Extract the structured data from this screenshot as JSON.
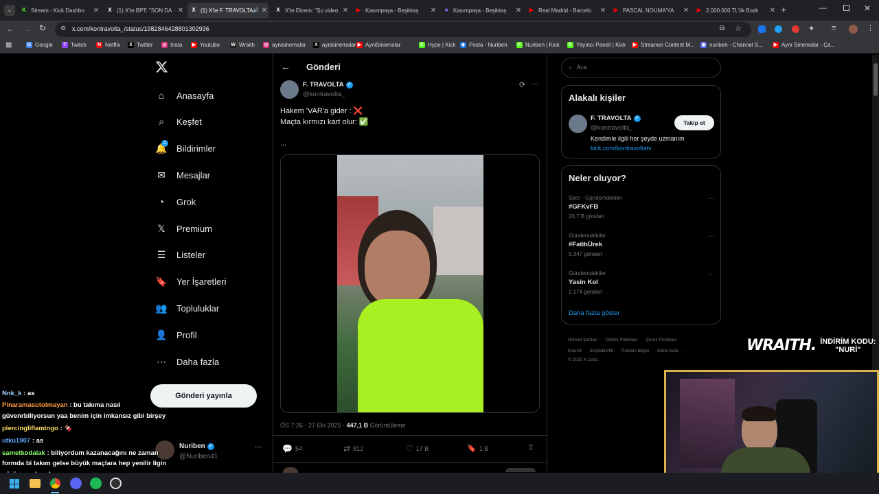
{
  "tabs": [
    {
      "title": "Stream - Kick Dashbo",
      "favicon": "K",
      "color": "#53fc18"
    },
    {
      "title": "(1) X'te BPT: \"SON DA",
      "favicon": "X",
      "color": "#000"
    },
    {
      "title": "(1) X'te F. TRAVOLTA",
      "favicon": "X",
      "color": "#000",
      "active": true
    },
    {
      "title": "X'te Ekrem: \"Şu video",
      "favicon": "X",
      "color": "#000"
    },
    {
      "title": "Kasımpaşa - Beşiktaş",
      "favicon": "▶",
      "color": "#ff0000"
    },
    {
      "title": "Kasımpaşa - Beşiktaş",
      "favicon": "■",
      "color": "#7b5cd6"
    },
    {
      "title": "Real Madrid - Barcelo",
      "favicon": "▶",
      "color": "#ff0000"
    },
    {
      "title": "PASCAL NOUMA'YA",
      "favicon": "▶",
      "color": "#ff0000"
    },
    {
      "title": "2.000.000 TL'lik Bozk",
      "favicon": "▶",
      "color": "#ff0000"
    }
  ],
  "browser": {
    "url": "x.com/kontravolta_/status/1982846428801302936"
  },
  "bookmarks": [
    {
      "label": "Google",
      "color": "#4285f4",
      "g": "G"
    },
    {
      "label": "Twitch",
      "color": "#9146ff",
      "g": "T"
    },
    {
      "label": "Netflix",
      "color": "#e50914",
      "g": "N"
    },
    {
      "label": "Twitter",
      "color": "#000",
      "g": "X"
    },
    {
      "label": "Insta",
      "color": "#d62976",
      "g": "◎"
    },
    {
      "label": "Youtube",
      "color": "#ff0000",
      "g": "▶"
    },
    {
      "label": "Wraith",
      "color": "#222",
      "g": "W"
    },
    {
      "label": "aynisinemalar",
      "color": "#d62976",
      "g": "◎"
    },
    {
      "label": "aynisinemalar",
      "color": "#000",
      "g": "X"
    },
    {
      "label": "AyniSinemalar",
      "color": "#ff0000",
      "g": "▶"
    },
    {
      "label": "Hype | Kick",
      "color": "#53fc18",
      "g": "K"
    },
    {
      "label": "Posta - Nuriben",
      "color": "#1a73e8",
      "g": "◆"
    },
    {
      "label": "Nuriben | Kick",
      "color": "#53fc18",
      "g": "K"
    },
    {
      "label": "Yayıncı Paneli | Kick",
      "color": "#53fc18",
      "g": "K"
    },
    {
      "label": "Streamer Content M...",
      "color": "#ff0000",
      "g": "▶"
    },
    {
      "label": "nuriben - Channel S...",
      "color": "#5865f2",
      "g": "◉"
    },
    {
      "label": "Aynı Sinemalar - Ça...",
      "color": "#ff0000",
      "g": "▶"
    }
  ],
  "nav": {
    "items": [
      {
        "label": "Anasayfa",
        "icon": "home-icon"
      },
      {
        "label": "Keşfet",
        "icon": "search-icon"
      },
      {
        "label": "Bildirimler",
        "icon": "bell-icon",
        "badge": "1"
      },
      {
        "label": "Mesajlar",
        "icon": "mail-icon"
      },
      {
        "label": "Grok",
        "icon": "grok-icon"
      },
      {
        "label": "Premium",
        "icon": "x-logo-icon"
      },
      {
        "label": "Listeler",
        "icon": "list-icon"
      },
      {
        "label": "Yer İşaretleri",
        "icon": "bookmark-icon"
      },
      {
        "label": "Topluluklar",
        "icon": "communities-icon"
      },
      {
        "label": "Profil",
        "icon": "profile-icon"
      },
      {
        "label": "Daha fazla",
        "icon": "more-circle-icon"
      }
    ],
    "post_button": "Gönderi yayınla",
    "account": {
      "name": "Nuriben",
      "handle": "@Nuriben41"
    }
  },
  "post": {
    "header_title": "Gönderi",
    "author_name": "F. TRAVOLTA",
    "author_handle": "@kontravolta_",
    "line1": "Hakem 'VAR'a gider : ❌",
    "line2": "Maçta kırmızı kart olur: ✅",
    "ellipsis": "...",
    "timestamp": "ÖS 7:26 · 27 Eki 2025 · ",
    "views": "447,1 B",
    "views_label": "Görüntüleme",
    "replies": "54",
    "reposts": "812",
    "likes": "17 B",
    "bookmarks": "1 B"
  },
  "search": {
    "placeholder": "Ara"
  },
  "related": {
    "title": "Alakalı kişiler",
    "name": "F. TRAVOLTA",
    "handle": "@kontravolta_",
    "follow": "Takip et",
    "bio": "Kendimle ilgili her şeyde uzmanım",
    "link": "kick.com/kontravoltatv"
  },
  "trends": {
    "title": "Neler oluyor?",
    "items": [
      {
        "context": "Spor · Gündemdekiler",
        "name": "#GFKvFB",
        "count": "20,7 B gönderi"
      },
      {
        "context": "Gündemdekiler",
        "name": "#FatihÜrek",
        "count": "5.347 gönderi"
      },
      {
        "context": "Gündemdekiler",
        "name": "Yasin Kol",
        "count": "2.174 gönderi"
      }
    ],
    "show_more": "Daha fazla göster"
  },
  "footer": {
    "row1": [
      "Hizmet Şartları",
      "Gizlilik Politikası",
      "Çerez Politikası"
    ],
    "row2": [
      "Imprint",
      "Erişilebilirlik",
      "Reklam bilgisi",
      "Daha fazla ···"
    ],
    "copyright": "© 2025 X Corp."
  },
  "overlay": {
    "brand": "WRAITH.",
    "code_label": "İNDİRİM KODU:",
    "code": "\"NURİ\""
  },
  "chat": [
    {
      "user": "Nnk_k",
      "color": "#a7d3ff",
      "text": ": as"
    },
    {
      "user": "Pinaramasutolmayan",
      "color": "#ff9a3c",
      "text": ": bu takıma nasıl"
    },
    {
      "user": "",
      "color": "#fff",
      "text": "güvenrbiliyorsun yaa benim için imkansız gibi birşey"
    },
    {
      "user": "piercingliflamingo",
      "color": "#ffe066",
      "text": ": 🍫"
    },
    {
      "user": "utku1907",
      "color": "#5fa8ff",
      "text": ": as"
    },
    {
      "user": "sametkodalak",
      "color": "#8cff6e",
      "text": ": biliyordum kazanacağını ne zaman"
    },
    {
      "user": "",
      "color": "#fff",
      "text": "formda bi takım gelse büyük maçlara hep yenilir ligin"
    },
    {
      "user": "",
      "color": "#fff",
      "text": "görünmez kuralı"
    }
  ],
  "colors": {
    "accent": "#1d9bf0",
    "kick": "#53fc18",
    "bg": "#000000",
    "border": "#2f3336"
  }
}
